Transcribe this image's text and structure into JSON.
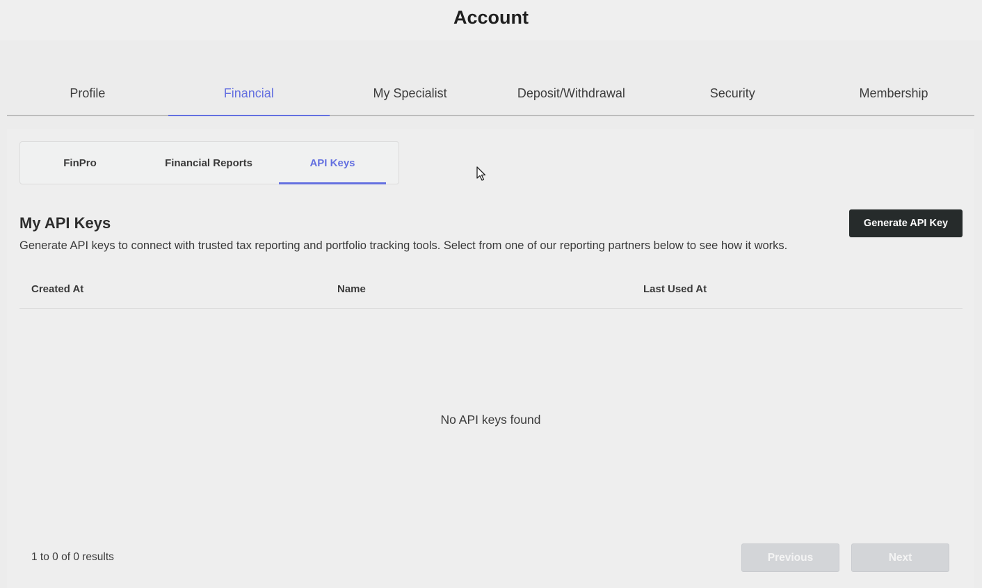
{
  "header": {
    "title": "Account"
  },
  "main_tabs": [
    {
      "label": "Profile"
    },
    {
      "label": "Financial",
      "active": true
    },
    {
      "label": "My Specialist"
    },
    {
      "label": "Deposit/Withdrawal"
    },
    {
      "label": "Security"
    },
    {
      "label": "Membership"
    }
  ],
  "sub_tabs": [
    {
      "label": "FinPro"
    },
    {
      "label": "Financial Reports"
    },
    {
      "label": "API Keys",
      "active": true
    }
  ],
  "section": {
    "title": "My API Keys",
    "description": "Generate API keys to connect with trusted tax reporting and portfolio tracking tools. Select from one of our reporting partners below to see how it works.",
    "generate_button": "Generate API Key"
  },
  "table": {
    "columns": [
      "Created At",
      "Name",
      "Last Used At"
    ],
    "rows": [],
    "empty_message": "No API keys found"
  },
  "pagination": {
    "summary": "1 to 0 of 0 results",
    "previous_label": "Previous",
    "next_label": "Next",
    "previous_disabled": true,
    "next_disabled": true
  },
  "colors": {
    "accent": "#6470e0",
    "primary_button": "#262b2b",
    "disabled_button": "#d3d5d8"
  }
}
